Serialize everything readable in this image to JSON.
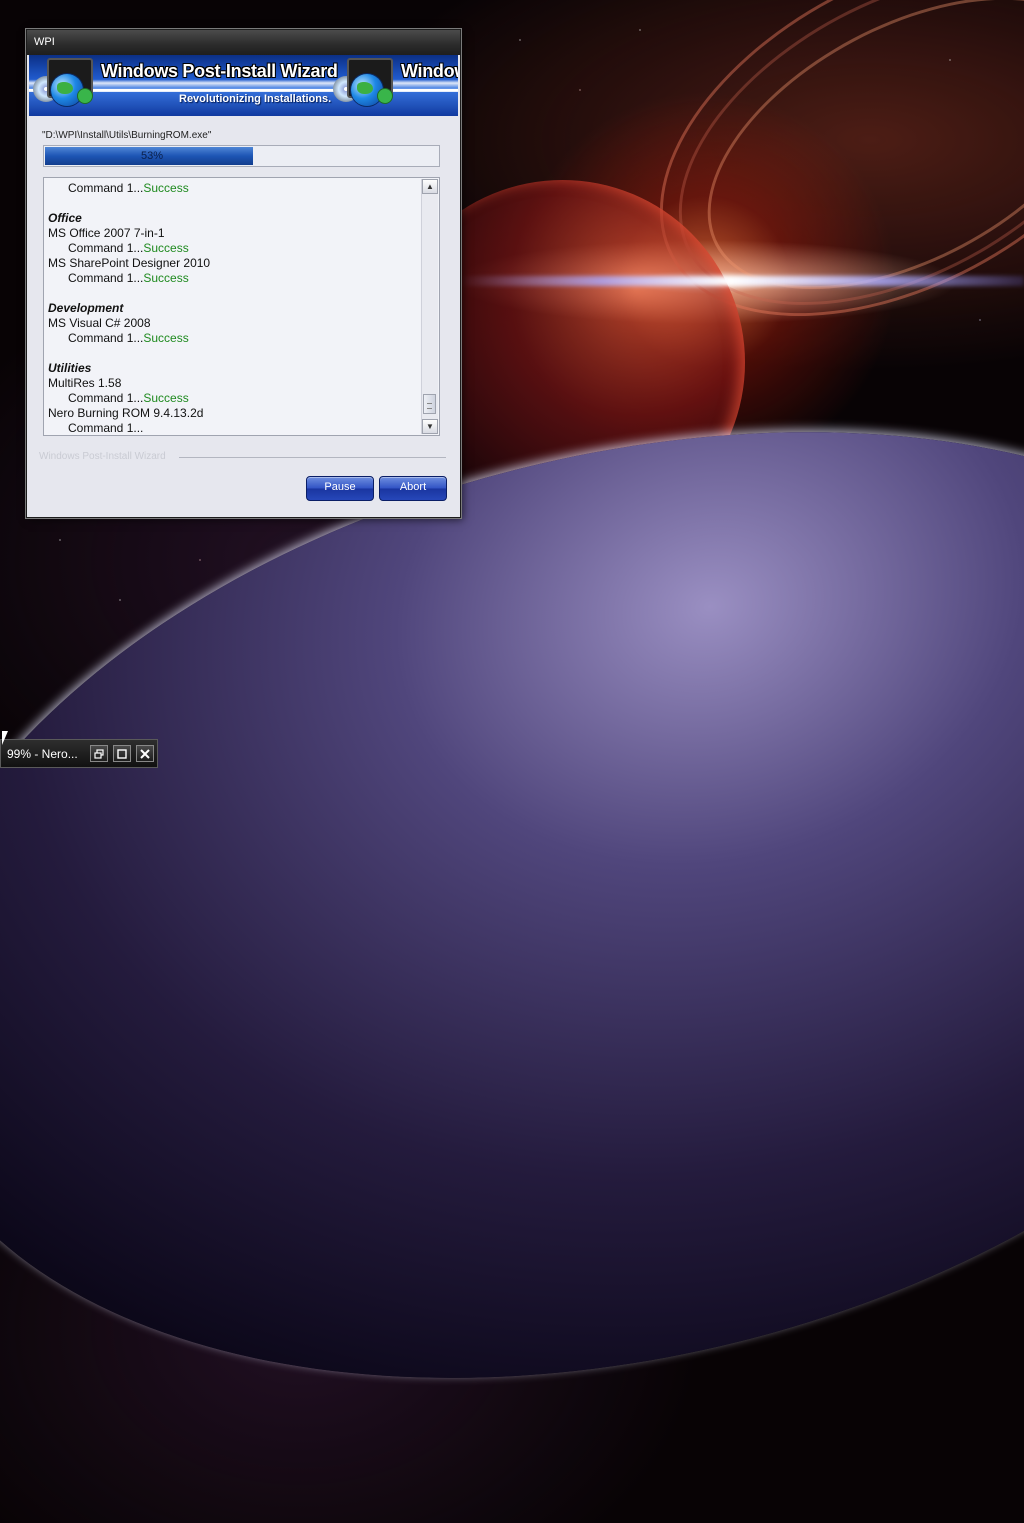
{
  "window": {
    "title": "WPI",
    "banner_title": "Windows Post-Install Wizard",
    "banner_title_clipped": "Window",
    "banner_subtitle": "Revolutionizing Installations."
  },
  "install": {
    "current_path": "\"D:\\WPI\\Install\\Utils\\BurningROM.exe\"",
    "progress_percent": 53,
    "progress_label": "53%"
  },
  "log": {
    "lines": [
      {
        "kind": "command",
        "text": "Command 1...",
        "status": "Success"
      },
      {
        "kind": "gap"
      },
      {
        "kind": "category",
        "text": "Office"
      },
      {
        "kind": "item",
        "text": "MS Office 2007 7-in-1"
      },
      {
        "kind": "command",
        "text": "Command 1...",
        "status": "Success"
      },
      {
        "kind": "item",
        "text": "MS SharePoint Designer 2010"
      },
      {
        "kind": "command",
        "text": "Command 1...",
        "status": "Success"
      },
      {
        "kind": "gap"
      },
      {
        "kind": "category",
        "text": "Development"
      },
      {
        "kind": "item",
        "text": "MS Visual C# 2008"
      },
      {
        "kind": "command",
        "text": "Command 1...",
        "status": "Success"
      },
      {
        "kind": "gap"
      },
      {
        "kind": "category",
        "text": "Utilities"
      },
      {
        "kind": "item",
        "text": "MultiRes 1.58"
      },
      {
        "kind": "command",
        "text": "Command 1...",
        "status": "Success"
      },
      {
        "kind": "item",
        "text": "Nero Burning ROM 9.4.13.2d"
      },
      {
        "kind": "command",
        "text": "Command 1...",
        "status": ""
      }
    ]
  },
  "footer": {
    "group_label": "Windows Post-Install Wizard",
    "pause_label": "Pause",
    "abort_label": "Abort"
  },
  "taskbar": {
    "minimized_label": "99% - Nero..."
  },
  "colors": {
    "success": "#1f8a1f",
    "button_blue": "#2647b9",
    "progress_blue": "#1d55b4"
  },
  "icons": {
    "scroll_up": "▲",
    "scroll_down": "▼",
    "restore": "restore-icon",
    "maximize": "maximize-icon",
    "close": "close-icon"
  }
}
